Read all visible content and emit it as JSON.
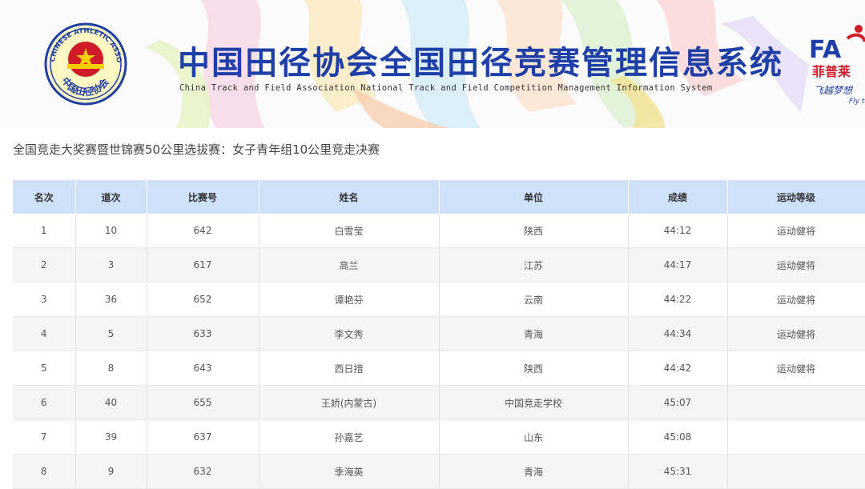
{
  "banner": {
    "title": "中国田径协会全国田径竞赛管理信息系统",
    "subtitle": "China Track and Field Association National Track and Field Competition Management Information System",
    "logo_left": {
      "ring_text": "CHINESE ATHLETIC ASSOCIATION",
      "bottom_text": "中国田径协会"
    },
    "sponsor": {
      "mark": "FA",
      "name": "菲普莱",
      "slogan": "飞越梦想",
      "slogan_en": "Fly to"
    }
  },
  "event_title": "全国竞走大奖赛暨世锦赛50公里选拔赛：女子青年组10公里竞走决赛",
  "colors": {
    "header_bg": "#cfe1f9",
    "title_blue": "#1f3fa8",
    "brand_red": "#d01c2a"
  },
  "table": {
    "columns": [
      "名次",
      "道次",
      "比赛号",
      "姓名",
      "单位",
      "成绩",
      "运动等级"
    ],
    "rows": [
      [
        "1",
        "10",
        "642",
        "白雪莹",
        "陕西",
        "44:12",
        "运动健将"
      ],
      [
        "2",
        "3",
        "617",
        "高兰",
        "江苏",
        "44:17",
        "运动健将"
      ],
      [
        "3",
        "36",
        "652",
        "谭艳芬",
        "云南",
        "44:22",
        "运动健将"
      ],
      [
        "4",
        "5",
        "633",
        "李文秀",
        "青海",
        "44:34",
        "运动健将"
      ],
      [
        "5",
        "8",
        "643",
        "西日措",
        "陕西",
        "44:42",
        "运动健将"
      ],
      [
        "6",
        "40",
        "655",
        "王娇(内蒙古)",
        "中国竞走学校",
        "45:07",
        ""
      ],
      [
        "7",
        "39",
        "637",
        "孙嘉艺",
        "山东",
        "45:08",
        ""
      ],
      [
        "8",
        "9",
        "632",
        "季海英",
        "青海",
        "45:31",
        ""
      ]
    ]
  }
}
